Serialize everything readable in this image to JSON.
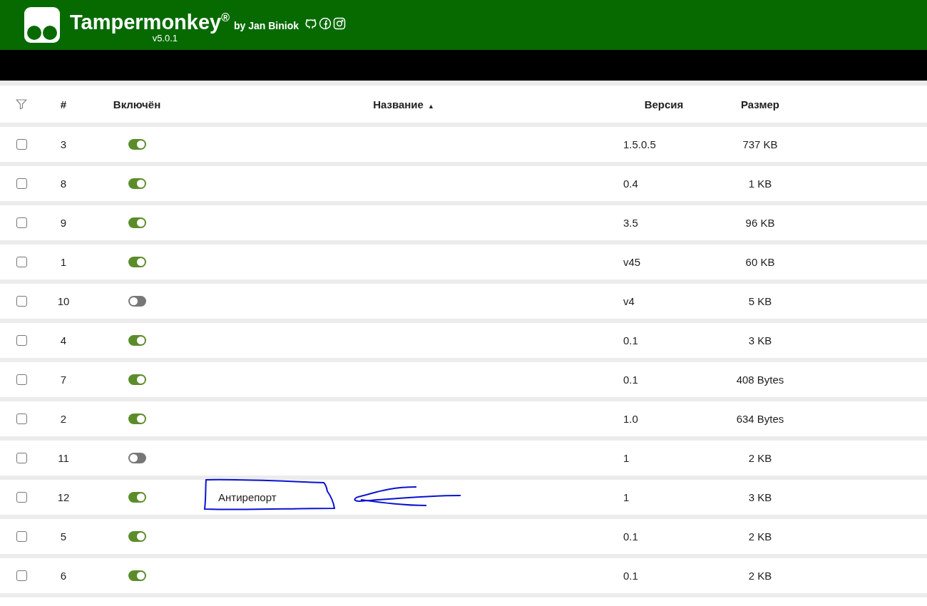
{
  "header": {
    "title": "Tampermonkey",
    "title_mark": "®",
    "author": "by Jan Biniok",
    "version": "v5.0.1"
  },
  "columns": [
    {
      "label": "#"
    },
    {
      "label": "Включён"
    },
    {
      "label": "Название",
      "sort": "▲"
    },
    {
      "label": "Версия"
    },
    {
      "label": "Размер"
    }
  ],
  "rows": [
    {
      "number": "3",
      "checked": false,
      "on": true,
      "version": "1.5.0.5",
      "size": "737 KB"
    },
    {
      "number": "8",
      "checked": false,
      "on": true,
      "version": "0.4",
      "size": "1 KB"
    },
    {
      "number": "9",
      "checked": false,
      "on": true,
      "version": "3.5",
      "size": "96 KB"
    },
    {
      "number": "1",
      "checked": false,
      "on": true,
      "version": "v45",
      "size": "60 KB"
    },
    {
      "number": "10",
      "checked": false,
      "on": false,
      "version": "v4",
      "size": "5 KB"
    },
    {
      "number": "4",
      "checked": false,
      "on": true,
      "version": "0.1",
      "size": "3 KB"
    },
    {
      "number": "7",
      "checked": false,
      "on": true,
      "version": "0.1",
      "size": "408 Bytes"
    },
    {
      "number": "2",
      "checked": false,
      "on": true,
      "version": "1.0",
      "size": "634 Bytes"
    },
    {
      "number": "11",
      "checked": false,
      "on": false,
      "version": "1",
      "size": "2 KB"
    },
    {
      "number": "12",
      "checked": false,
      "on": true,
      "name": "Антирепорт",
      "annotated": true,
      "version": "1",
      "size": "3 KB"
    },
    {
      "number": "5",
      "checked": false,
      "on": true,
      "version": "0.1",
      "size": "2 KB"
    },
    {
      "number": "6",
      "checked": false,
      "on": true,
      "version": "0.1",
      "size": "2 KB"
    }
  ]
}
